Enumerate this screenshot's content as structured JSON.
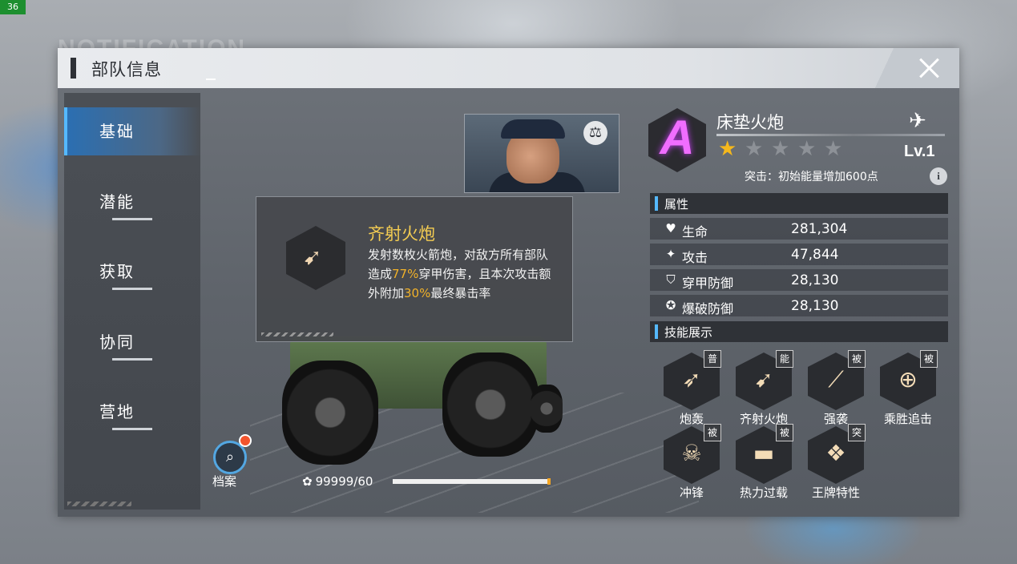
{
  "debug": {
    "fps": "36"
  },
  "background": {
    "watermark": "NOTIFICATION"
  },
  "header": {
    "title": "部队信息"
  },
  "sidebar": {
    "items": [
      {
        "label": "基础",
        "active": true
      },
      {
        "label": "潜能",
        "active": false
      },
      {
        "label": "获取",
        "active": false
      },
      {
        "label": "协同",
        "active": false
      },
      {
        "label": "营地",
        "active": false
      }
    ]
  },
  "popup": {
    "title": "齐射火炮",
    "desc_1": "发射数枚火箭炮，对敌方所有部队造成",
    "desc_hl_1": "77%",
    "desc_2": "穿甲伤害，且本次攻击额外附加",
    "desc_hl_2": "30%",
    "desc_3": "最终暴击率",
    "icon": "rocket-salvo-icon"
  },
  "archive": {
    "label": "档案",
    "icon": "magnify-icon"
  },
  "energy": {
    "text": "99999/60",
    "fill_fraction": 1.0
  },
  "unit": {
    "rank": "A",
    "name": "床垫火炮",
    "stars_total": 5,
    "stars_lit": 1,
    "level": "Lv.1",
    "breakthrough": "突击：初始能量增加600点",
    "class_icon": "jet-icon"
  },
  "attributes": {
    "heading": "属性",
    "rows": [
      {
        "icon": "heart-icon",
        "glyph": "♥",
        "name": "生命",
        "value": "281,304"
      },
      {
        "icon": "attack-icon",
        "glyph": "✦",
        "name": "攻击",
        "value": "47,844"
      },
      {
        "icon": "armor-shield-icon",
        "glyph": "⛉",
        "name": "穿甲防御",
        "value": "28,130"
      },
      {
        "icon": "blast-shield-icon",
        "glyph": "✪",
        "name": "爆破防御",
        "value": "28,130"
      }
    ]
  },
  "skills": {
    "heading": "技能展示",
    "items": [
      {
        "name": "炮轰",
        "tag": "普",
        "icon": "shell-icon",
        "glyph": "➶"
      },
      {
        "name": "齐射火炮",
        "tag": "能",
        "icon": "rocket-salvo-icon",
        "glyph": "➹"
      },
      {
        "name": "强袭",
        "tag": "被",
        "icon": "slash-icon",
        "glyph": "⟋"
      },
      {
        "name": "乘胜追击",
        "tag": "被",
        "icon": "crosshair-icon",
        "glyph": "⊕"
      },
      {
        "name": "冲锋",
        "tag": "被",
        "icon": "skull-icon",
        "glyph": "☠"
      },
      {
        "name": "热力过载",
        "tag": "被",
        "icon": "tank-icon",
        "glyph": "▬"
      },
      {
        "name": "王牌特性",
        "tag": "突",
        "icon": "ace-emblem-icon",
        "glyph": "❖"
      }
    ]
  }
}
